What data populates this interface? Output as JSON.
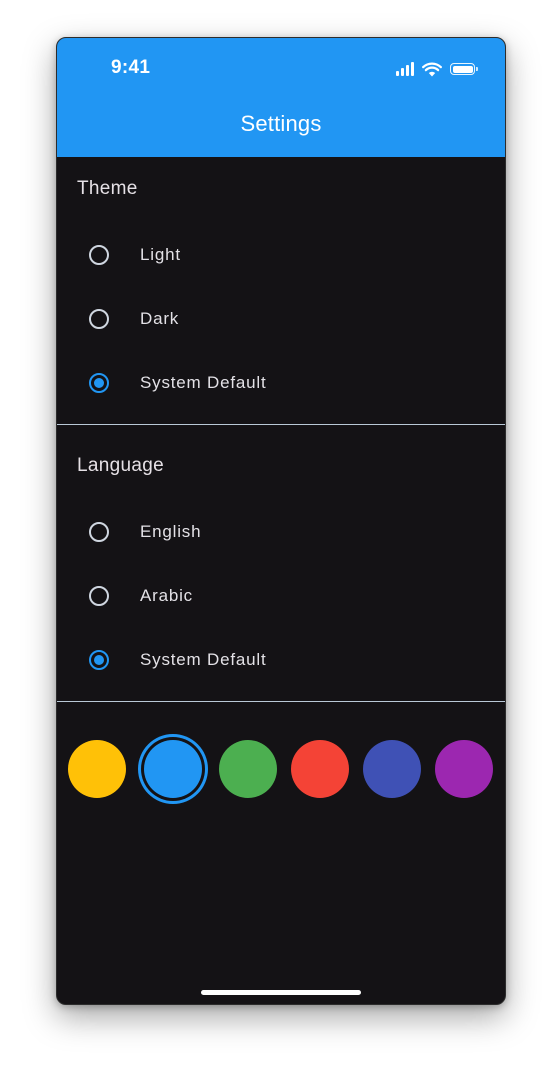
{
  "status_bar": {
    "time": "9:41",
    "icons": [
      "cellular-signal-icon",
      "wifi-icon",
      "battery-icon"
    ]
  },
  "app_bar": {
    "title": "Settings",
    "color": "#2196f3"
  },
  "theme_section": {
    "title": "Theme",
    "options": [
      {
        "label": "Light",
        "selected": false
      },
      {
        "label": "Dark",
        "selected": false
      },
      {
        "label": "System Default",
        "selected": true
      }
    ]
  },
  "language_section": {
    "title": "Language",
    "options": [
      {
        "label": "English",
        "selected": false
      },
      {
        "label": "Arabic",
        "selected": false
      },
      {
        "label": "System Default",
        "selected": true
      }
    ]
  },
  "color_swatches": [
    {
      "color": "#ffc107",
      "selected": false
    },
    {
      "color": "#2196f3",
      "selected": true
    },
    {
      "color": "#4caf50",
      "selected": false
    },
    {
      "color": "#f44336",
      "selected": false
    },
    {
      "color": "#3f51b5",
      "selected": false
    },
    {
      "color": "#9c27b0",
      "selected": false
    }
  ],
  "colors": {
    "background": "#141215",
    "accent": "#2196f3",
    "text": "#e3e1e6",
    "divider": "#b9c8d6"
  }
}
